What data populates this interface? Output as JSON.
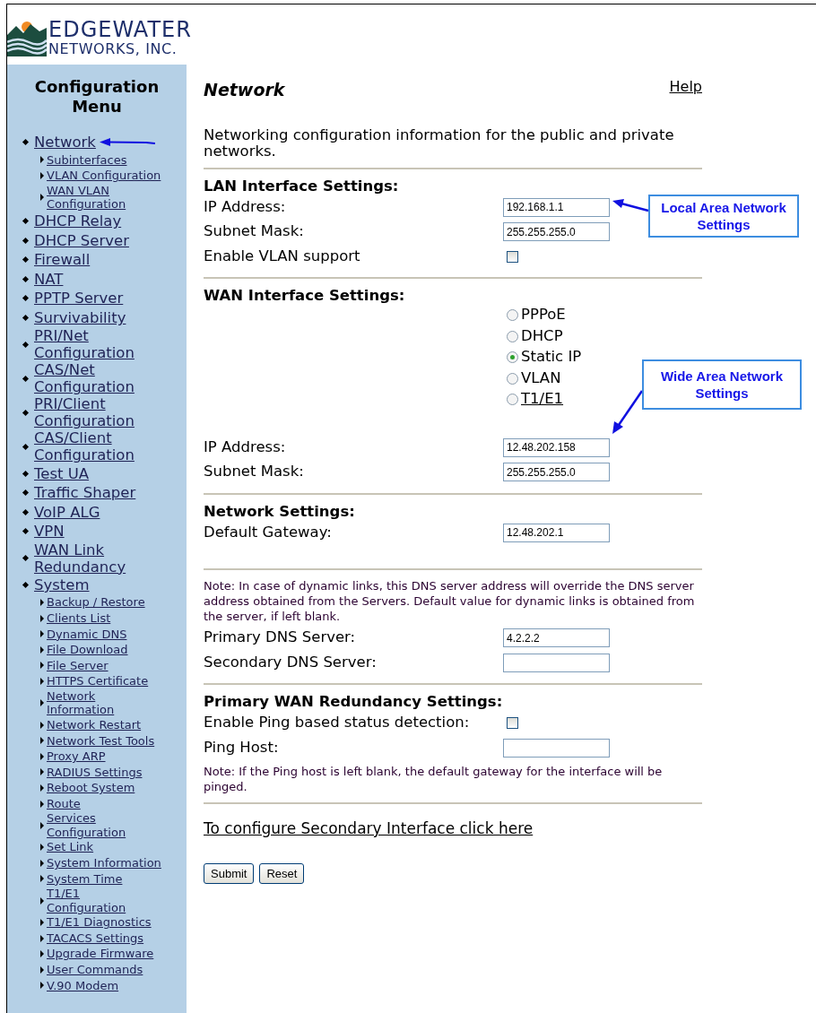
{
  "logo": {
    "line1": "EDGEWATER",
    "line2": "NETWORKS, INC."
  },
  "sidebar": {
    "title": "Configuration Menu",
    "items": [
      {
        "label": "Network",
        "pointer_arrow": true,
        "children": [
          {
            "label": "Subinterfaces"
          },
          {
            "label": "VLAN Configuration"
          },
          {
            "label": "WAN VLAN Configuration"
          }
        ]
      },
      {
        "label": "DHCP Relay"
      },
      {
        "label": "DHCP Server"
      },
      {
        "label": "Firewall"
      },
      {
        "label": "NAT"
      },
      {
        "label": "PPTP Server"
      },
      {
        "label": "Survivability"
      },
      {
        "label": "PRI/Net Configuration"
      },
      {
        "label": "CAS/Net Configuration"
      },
      {
        "label": "PRI/Client Configuration"
      },
      {
        "label": "CAS/Client Configuration"
      },
      {
        "label": "Test UA"
      },
      {
        "label": "Traffic Shaper"
      },
      {
        "label": "VoIP ALG"
      },
      {
        "label": "VPN"
      },
      {
        "label": "WAN Link Redundancy"
      },
      {
        "label": "System",
        "children": [
          {
            "label": "Backup / Restore"
          },
          {
            "label": "Clients List"
          },
          {
            "label": "Dynamic DNS"
          },
          {
            "label": "File Download"
          },
          {
            "label": "File Server"
          },
          {
            "label": "HTTPS Certificate"
          },
          {
            "label": "Network Information"
          },
          {
            "label": "Network Restart"
          },
          {
            "label": "Network Test Tools"
          },
          {
            "label": "Proxy ARP"
          },
          {
            "label": "RADIUS Settings"
          },
          {
            "label": "Reboot System"
          },
          {
            "label": "Route"
          },
          {
            "label": "Services Configuration"
          },
          {
            "label": "Set Link"
          },
          {
            "label": "System Information"
          },
          {
            "label": "System Time"
          },
          {
            "label": "T1/E1 Configuration"
          },
          {
            "label": "T1/E1 Diagnostics"
          },
          {
            "label": "TACACS Settings"
          },
          {
            "label": "Upgrade Firmware"
          },
          {
            "label": "User Commands"
          },
          {
            "label": "V.90 Modem"
          }
        ]
      }
    ]
  },
  "help_link": "Help",
  "page": {
    "title": "Network",
    "intro": "Networking configuration information for the public and private networks."
  },
  "sections": [
    {
      "heading": "LAN Interface Settings:",
      "rows": [
        {
          "kind": "text",
          "label": "IP Address:",
          "value": "192.168.1.1",
          "callout": {
            "text": "Local Area Network Settings",
            "kind": "side"
          }
        },
        {
          "kind": "text",
          "label": "Subnet Mask:",
          "value": "255.255.255.0"
        },
        {
          "kind": "checkbox",
          "label": "Enable VLAN support",
          "checked": false
        }
      ]
    },
    {
      "heading": "WAN Interface Settings:",
      "rows": [
        {
          "kind": "radio",
          "options": [
            {
              "label": "PPPoE",
              "selected": false,
              "link": false
            },
            {
              "label": "DHCP",
              "selected": false,
              "link": false
            },
            {
              "label": "Static IP",
              "selected": true,
              "link": false
            },
            {
              "label": "VLAN",
              "selected": false,
              "link": false
            },
            {
              "label": "T1/E1",
              "selected": false,
              "link": true
            }
          ]
        },
        {
          "kind": "text",
          "label": "IP Address:",
          "value": "12.48.202.158",
          "callout": {
            "text": "Wide Area Network Settings",
            "kind": "above"
          }
        },
        {
          "kind": "text",
          "label": "Subnet Mask:",
          "value": "255.255.255.0"
        }
      ]
    },
    {
      "heading": "Network Settings:",
      "rows": [
        {
          "kind": "text",
          "label": "Default Gateway:",
          "value": "12.48.202.1"
        }
      ]
    },
    {
      "rows": [
        {
          "kind": "note",
          "text": "Note: In case of dynamic links, this DNS server address will override the DNS server address obtained from the Servers. Default value for dynamic links is obtained from the server, if left blank."
        },
        {
          "kind": "text",
          "label": "Primary DNS Server:",
          "value": "4.2.2.2"
        },
        {
          "kind": "text",
          "label": "Secondary DNS Server:"
        }
      ]
    },
    {
      "heading": "Primary WAN Redundancy Settings:",
      "rows": [
        {
          "kind": "checkbox",
          "label": "Enable Ping based status detection:",
          "checked": false
        },
        {
          "kind": "text",
          "label": "Ping Host:"
        },
        {
          "kind": "note",
          "text": "Note: If the Ping host is left blank, the default gateway for the interface will be pinged."
        }
      ]
    }
  ],
  "secondary_link": "To configure Secondary Interface click here",
  "buttons": [
    "Submit",
    "Reset"
  ]
}
